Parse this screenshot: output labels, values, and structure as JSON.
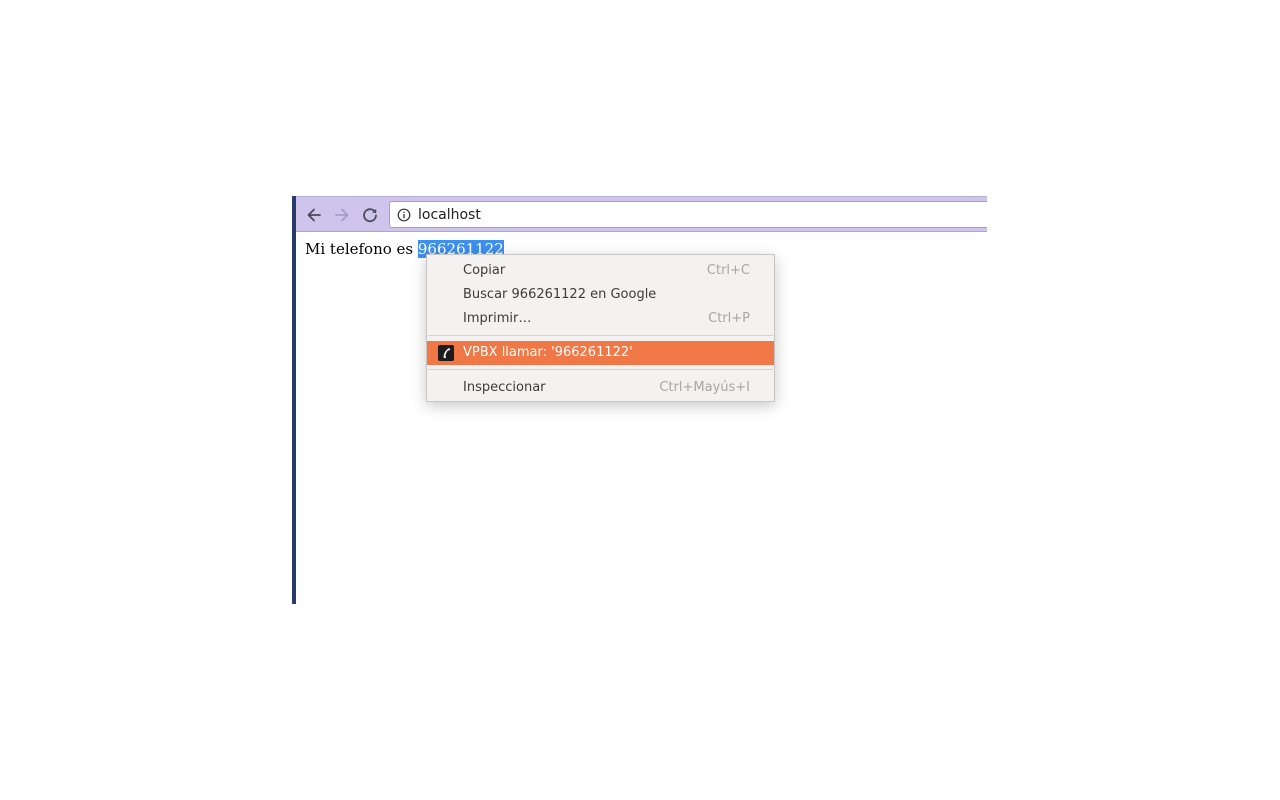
{
  "browser": {
    "nav": {
      "back_icon": "arrow-left-icon",
      "forward_icon": "arrow-right-icon",
      "reload_icon": "reload-icon"
    },
    "omnibox": {
      "icon": "info-icon",
      "url": "localhost"
    },
    "colors": {
      "toolbar": "#cec4ec",
      "selection": "#3d8ff0",
      "menu_highlight": "#f07746"
    }
  },
  "page": {
    "text_before": "Mi telefono es ",
    "selected_text": "966261122"
  },
  "context_menu": {
    "items": [
      {
        "label": "Copiar",
        "shortcut": "Ctrl+C"
      },
      {
        "label": "Buscar 966261122 en Google",
        "shortcut": ""
      },
      {
        "label": "Imprimir…",
        "shortcut": "Ctrl+P"
      },
      {
        "label": "VPBX llamar: '966261122'",
        "shortcut": "",
        "icon": "phone-icon",
        "highlighted": true
      },
      {
        "label": "Inspeccionar",
        "shortcut": "Ctrl+Mayús+I"
      }
    ]
  }
}
